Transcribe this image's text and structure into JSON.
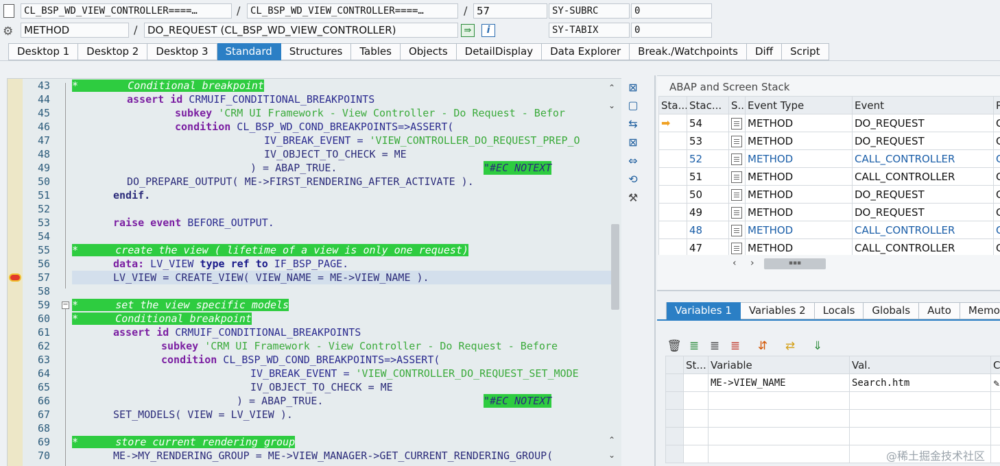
{
  "header": {
    "row1": {
      "field1": "CL_BSP_WD_VIEW_CONTROLLER====…",
      "field2": "CL_BSP_WD_VIEW_CONTROLLER====…",
      "line": "57",
      "sysvar": "SY-SUBRC",
      "sysval": "0"
    },
    "row2": {
      "type": "METHOD",
      "name": "DO_REQUEST (CL_BSP_WD_VIEW_CONTROLLER)",
      "sysvar": "SY-TABIX",
      "sysval": "0"
    },
    "sep": "/"
  },
  "tabs": [
    "Desktop 1",
    "Desktop 2",
    "Desktop 3",
    "Standard",
    "Structures",
    "Tables",
    "Objects",
    "DetailDisplay",
    "Data Explorer",
    "Break./Watchpoints",
    "Diff",
    "Script"
  ],
  "active_tab": "Standard",
  "code": {
    "line_numbers": [
      "43",
      "44",
      "45",
      "46",
      "47",
      "48",
      "49",
      "50",
      "51",
      "52",
      "53",
      "54",
      "55",
      "56",
      "57",
      "58",
      "59",
      "60",
      "61",
      "62",
      "63",
      "64",
      "65",
      "66",
      "67",
      "68",
      "69",
      "70"
    ],
    "segments": {
      "l43": "*        Conditional breakpoint",
      "l44a": "assert id",
      "l44b": " CRMUIF_CONDITIONAL_BREAKPOINTS",
      "l45a": "subkey",
      "l45b": " 'CRM UI Framework - View Controller - Do Request - Befor",
      "l46a": "condition",
      "l46b": " CL_BSP_WD_COND_BREAKPOINTS=>ASSERT(",
      "l47a": "IV_BREAK_EVENT = ",
      "l47b": "'VIEW_CONTROLLER_DO_REQUEST_PREP_O",
      "l48": "IV_OBJECT_TO_CHECK = ME",
      "l49a": ") = ABAP_TRUE.",
      "l49b": "\"#EC NOTEXT",
      "l50": "DO_PREPARE_OUTPUT( ME->FIRST_RENDERING_AFTER_ACTIVATE ).",
      "l51": "endif.",
      "l53a": "raise event",
      "l53b": " BEFORE_OUTPUT.",
      "l55": "*      create the view ( lifetime of a view is only one request)",
      "l56a": "data:",
      "l56b": " LV_VIEW ",
      "l56c": "type ref to",
      "l56d": " IF_BSP_PAGE.",
      "l57": "LV_VIEW = CREATE_VIEW( VIEW_NAME = ME->VIEW_NAME ).",
      "l59": "*      set the view specific models",
      "l60": "*      Conditional breakpoint",
      "l61a": "assert id",
      "l61b": " CRMUIF_CONDITIONAL_BREAKPOINTS",
      "l62a": "subkey",
      "l62b": " 'CRM UI Framework - View Controller - Do Request - Before",
      "l63a": "condition",
      "l63b": " CL_BSP_WD_COND_BREAKPOINTS=>ASSERT(",
      "l64a": "IV_BREAK_EVENT = ",
      "l64b": "'VIEW_CONTROLLER_DO_REQUEST_SET_MODE",
      "l65": "IV_OBJECT_TO_CHECK = ME",
      "l66a": ") = ABAP_TRUE.",
      "l66b": "\"#EC NOTEXT",
      "l67": "SET_MODELS( VIEW = LV_VIEW ).",
      "l69": "*      store current rendering group",
      "l70": "ME->MY_RENDERING_GROUP = ME->VIEW_MANAGER->GET_CURRENT_RENDERING_GROUP("
    }
  },
  "stack": {
    "title": "ABAP and Screen Stack",
    "columns": [
      "Sta...",
      "Stac...",
      "S..",
      "Event Type",
      "Event",
      "P"
    ],
    "rows": [
      {
        "level": "54",
        "type": "METHOD",
        "event": "DO_REQUEST",
        "p": "C"
      },
      {
        "level": "53",
        "type": "METHOD",
        "event": "DO_REQUEST",
        "p": "C"
      },
      {
        "level": "52",
        "type": "METHOD",
        "event": "CALL_CONTROLLER",
        "p": "C"
      },
      {
        "level": "51",
        "type": "METHOD",
        "event": "CALL_CONTROLLER",
        "p": "C"
      },
      {
        "level": "50",
        "type": "METHOD",
        "event": "DO_REQUEST",
        "p": "C"
      },
      {
        "level": "49",
        "type": "METHOD",
        "event": "DO_REQUEST",
        "p": "C"
      },
      {
        "level": "48",
        "type": "METHOD",
        "event": "CALL_CONTROLLER",
        "p": "C"
      },
      {
        "level": "47",
        "type": "METHOD",
        "event": "CALL_CONTROLLER",
        "p": "C"
      }
    ]
  },
  "var_tabs": [
    "Variables 1",
    "Variables 2",
    "Locals",
    "Globals",
    "Auto",
    "Memo"
  ],
  "variables": {
    "columns": [
      "St...",
      "Variable",
      "Val.",
      "C"
    ],
    "rows": [
      {
        "variable": "ME->VIEW_NAME",
        "value": "Search.htm"
      }
    ]
  },
  "watermark": "@稀土掘金技术社区",
  "colors": {
    "accent": "#2b7fc5",
    "comment_bg": "#2ecc40",
    "link": "#1a5ea8"
  }
}
